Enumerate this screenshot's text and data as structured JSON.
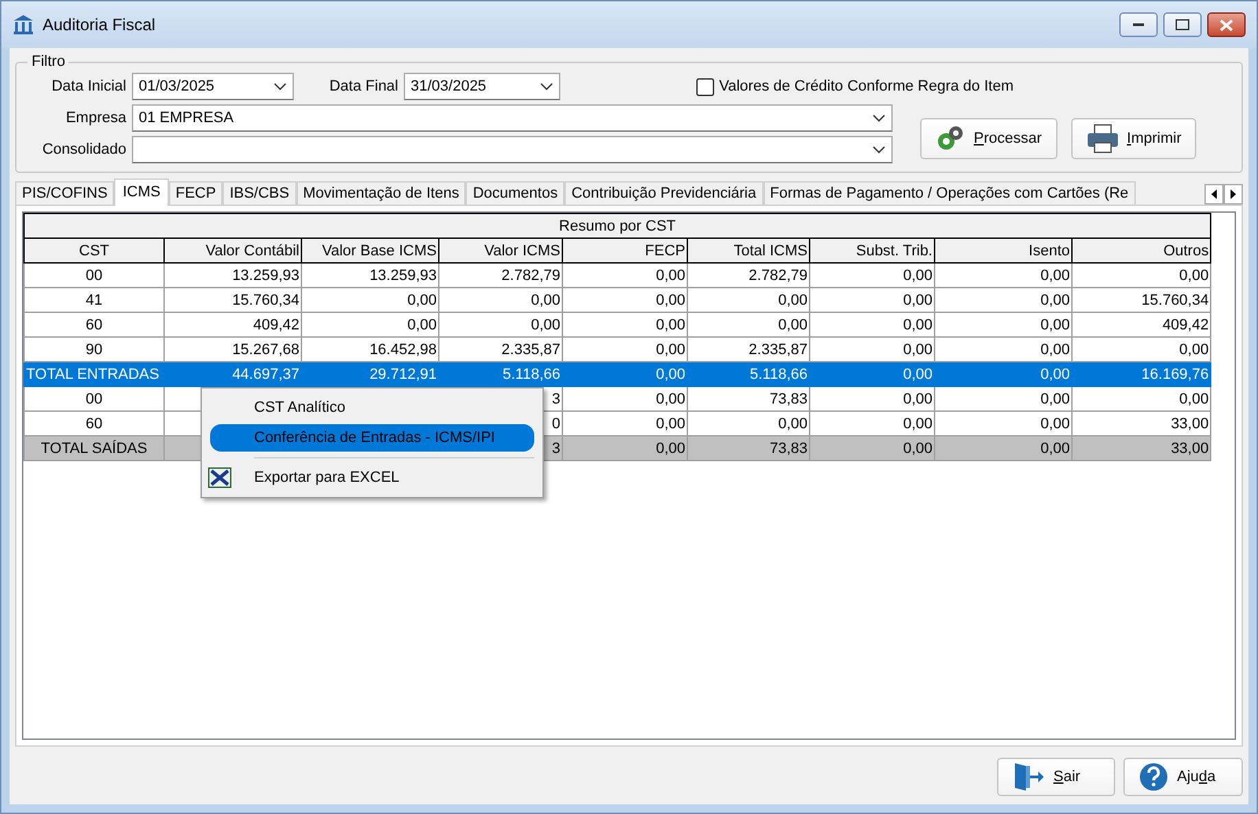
{
  "window": {
    "title": "Auditoria Fiscal"
  },
  "filter": {
    "legend": "Filtro",
    "data_inicial": {
      "label": "Data Inicial",
      "value": "01/03/2025"
    },
    "data_final": {
      "label": "Data Final",
      "value": "31/03/2025"
    },
    "credit_option": {
      "label": "Valores de Crédito Conforme Regra do Item",
      "checked": false
    },
    "empresa": {
      "label": "Empresa",
      "value": "01 EMPRESA"
    },
    "consolidado": {
      "label": "Consolidado"
    },
    "buttons": [
      {
        "label": "Processar"
      },
      {
        "label": "Imprimir"
      }
    ]
  },
  "tabs": [
    {
      "label": "PIS/COFINS",
      "selected": false
    },
    {
      "label": "ICMS",
      "selected": true
    },
    {
      "label": "FECP",
      "selected": false
    },
    {
      "label": "IBS/CBS",
      "selected": false
    },
    {
      "label": "Movimentação de Itens",
      "selected": false
    },
    {
      "label": "Documentos",
      "selected": false
    },
    {
      "label": "Contribuição Previdenciária",
      "selected": false
    },
    {
      "label": "Formas de Pagamento / Operações com Cartões  (Re",
      "selected": false
    }
  ],
  "table": {
    "title": "Resumo por CST",
    "columns": [
      "CST",
      "Valor Contábil",
      "Valor Base ICMS",
      "Valor ICMS",
      "FECP",
      "Total ICMS",
      "Subst. Trib.",
      "Isento",
      "Outros"
    ],
    "rows": [
      {
        "kind": "item",
        "selected": false,
        "cells": [
          "00",
          "13.259,93",
          "13.259,93",
          "2.782,79",
          "0,00",
          "2.782,79",
          "0,00",
          "0,00",
          "0,00"
        ]
      },
      {
        "kind": "item",
        "selected": false,
        "cells": [
          "41",
          "15.760,34",
          "0,00",
          "0,00",
          "0,00",
          "0,00",
          "0,00",
          "0,00",
          "15.760,34"
        ]
      },
      {
        "kind": "item",
        "selected": false,
        "cells": [
          "60",
          "409,42",
          "0,00",
          "0,00",
          "0,00",
          "0,00",
          "0,00",
          "0,00",
          "409,42"
        ]
      },
      {
        "kind": "item",
        "selected": false,
        "cells": [
          "90",
          "15.267,68",
          "16.452,98",
          "2.335,87",
          "0,00",
          "2.335,87",
          "0,00",
          "0,00",
          "0,00"
        ]
      },
      {
        "kind": "total",
        "selected": true,
        "cells": [
          "TOTAL ENTRADAS",
          "44.697,37",
          "29.712,91",
          "5.118,66",
          "0,00",
          "5.118,66",
          "0,00",
          "0,00",
          "16.169,76"
        ]
      },
      {
        "kind": "item",
        "selected": false,
        "cells": [
          "00",
          null,
          null,
          "3",
          "0,00",
          "73,83",
          "0,00",
          "0,00",
          "0,00"
        ]
      },
      {
        "kind": "item",
        "selected": false,
        "cells": [
          "60",
          null,
          null,
          "0",
          "0,00",
          "0,00",
          "0,00",
          "0,00",
          "33,00"
        ]
      },
      {
        "kind": "subtotal",
        "selected": false,
        "cells": [
          "TOTAL SAÍDAS",
          null,
          null,
          "3",
          "0,00",
          "73,83",
          "0,00",
          "0,00",
          "33,00"
        ]
      }
    ]
  },
  "context_menu": {
    "items": [
      {
        "kind": "item",
        "label": "CST Analítico",
        "selected": false
      },
      {
        "kind": "item",
        "label": "Conferência de Entradas - ICMS/IPI",
        "selected": true
      },
      {
        "kind": "separator"
      },
      {
        "kind": "export",
        "label": "Exportar para EXCEL",
        "selected": false
      }
    ]
  },
  "footer": {
    "buttons": [
      {
        "label": "Sair"
      },
      {
        "label": "Ajuda"
      }
    ]
  }
}
